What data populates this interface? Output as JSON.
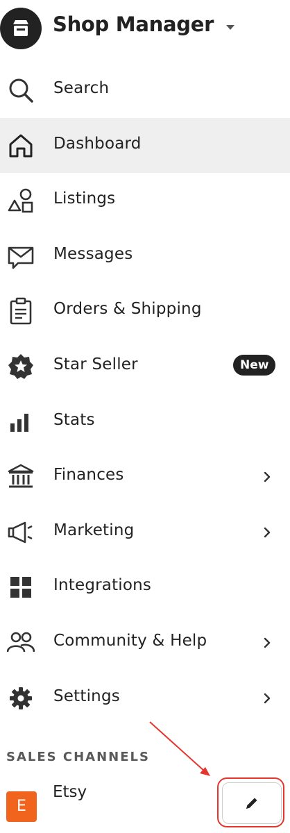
{
  "header": {
    "title": "Shop Manager",
    "logo_icon": "shop-icon"
  },
  "nav": {
    "items": [
      {
        "label": "Search",
        "icon": "search-icon",
        "active": false,
        "has_chevron": false
      },
      {
        "label": "Dashboard",
        "icon": "home-icon",
        "active": true,
        "has_chevron": false
      },
      {
        "label": "Listings",
        "icon": "shapes-icon",
        "active": false,
        "has_chevron": false
      },
      {
        "label": "Messages",
        "icon": "mail-icon",
        "active": false,
        "has_chevron": false
      },
      {
        "label": "Orders & Shipping",
        "icon": "clipboard-icon",
        "active": false,
        "has_chevron": false
      },
      {
        "label": "Star Seller",
        "icon": "star-badge-icon",
        "active": false,
        "has_chevron": false,
        "badge": "New"
      },
      {
        "label": "Stats",
        "icon": "bar-chart-icon",
        "active": false,
        "has_chevron": false
      },
      {
        "label": "Finances",
        "icon": "bank-icon",
        "active": false,
        "has_chevron": true
      },
      {
        "label": "Marketing",
        "icon": "megaphone-icon",
        "active": false,
        "has_chevron": true
      },
      {
        "label": "Integrations",
        "icon": "grid-icon",
        "active": false,
        "has_chevron": false
      },
      {
        "label": "Community & Help",
        "icon": "people-icon",
        "active": false,
        "has_chevron": true
      },
      {
        "label": "Settings",
        "icon": "gear-icon",
        "active": false,
        "has_chevron": true
      }
    ]
  },
  "sales_channels": {
    "title": "SALES CHANNELS",
    "channels": [
      {
        "label": "Etsy",
        "logo_letter": "E",
        "edit_icon": "pencil-icon"
      }
    ]
  },
  "colors": {
    "active_bg": "#efefef",
    "text": "#222222",
    "etsy_orange": "#f1641e",
    "annotation_red": "#e6352d"
  }
}
